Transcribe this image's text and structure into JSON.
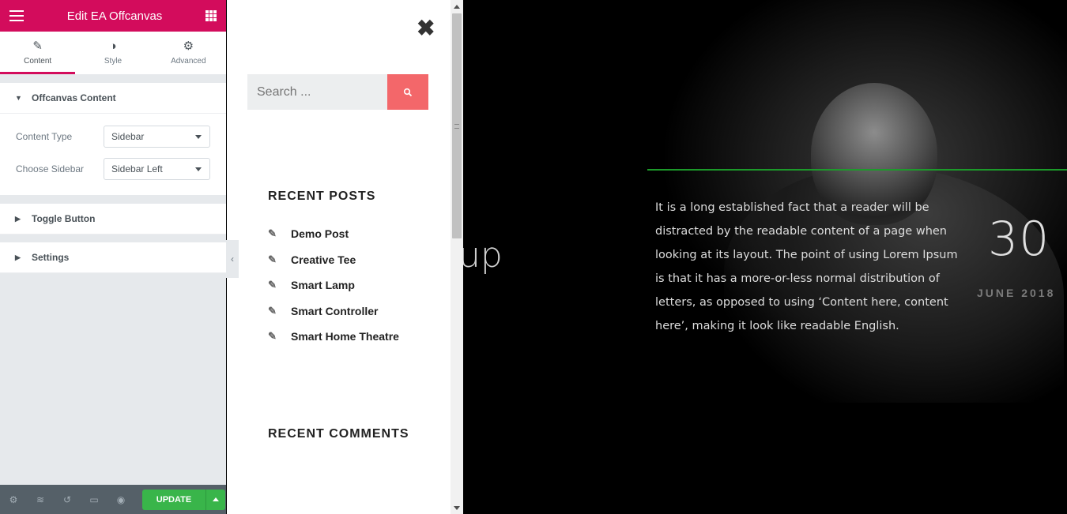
{
  "editor": {
    "title": "Edit EA Offcanvas",
    "tabs": [
      {
        "label": "Content",
        "icon": "pencil-icon"
      },
      {
        "label": "Style",
        "icon": "half-circle-icon"
      },
      {
        "label": "Advanced",
        "icon": "gear-icon"
      }
    ],
    "sections": {
      "content": {
        "title": "Offcanvas Content",
        "controls": [
          {
            "label": "Content Type",
            "value": "Sidebar"
          },
          {
            "label": "Choose Sidebar",
            "value": "Sidebar Left"
          }
        ]
      },
      "toggle": {
        "title": "Toggle Button"
      },
      "settings": {
        "title": "Settings"
      }
    },
    "footer": {
      "update_label": "UPDATE"
    }
  },
  "offcanvas": {
    "search": {
      "placeholder": "Search ..."
    },
    "recent_posts": {
      "title": "RECENT POSTS",
      "items": [
        "Demo Post",
        "Creative Tee",
        "Smart Lamp",
        "Smart Controller",
        "Smart Home Theatre"
      ]
    },
    "recent_comments": {
      "title": "RECENT COMMENTS"
    }
  },
  "preview": {
    "partial_heading": "up",
    "body": "It is a long established fact that a reader will be distracted by the readable content of a page when looking at its layout. The point of using Lorem Ipsum is that it has a more-or-less normal distribution of letters, as opposed to using ‘Content here, content here’, making it look like readable English.",
    "date_day": "30",
    "date_month": "JUNE 2018"
  },
  "colors": {
    "brand": "#d30c5c",
    "update": "#39b54a",
    "search_button": "#f3676a",
    "divider_line": "#1c9a2a"
  }
}
